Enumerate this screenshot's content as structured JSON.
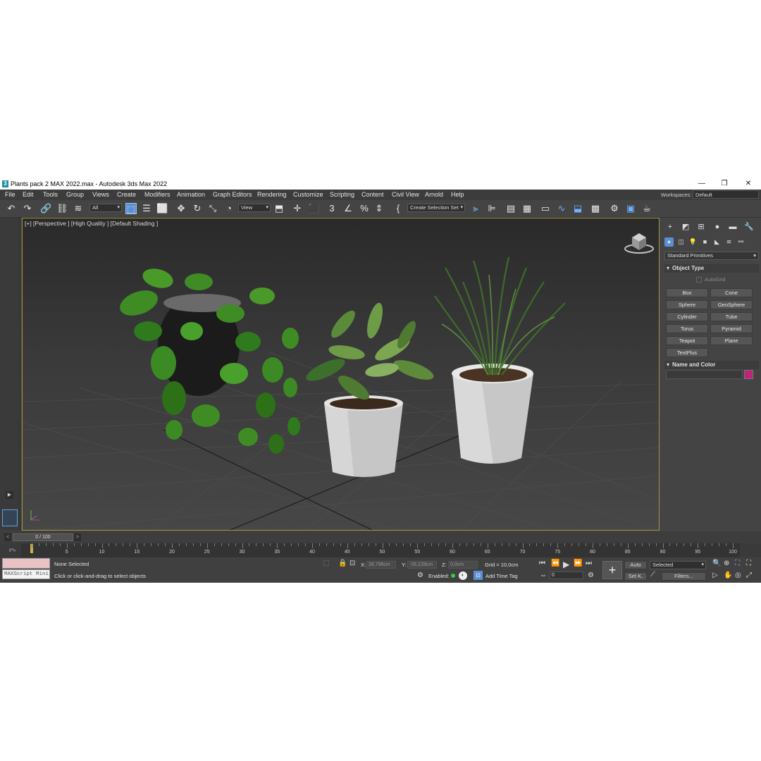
{
  "window": {
    "title": "Plants pack 2 MAX 2022.max - Autodesk 3ds Max 2022",
    "app_icon": "3",
    "min": "—",
    "max": "❐",
    "close": "✕"
  },
  "menu": [
    "File",
    "Edit",
    "Tools",
    "Group",
    "Views",
    "Create",
    "Modifiers",
    "Animation",
    "Graph Editors",
    "Rendering",
    "Customize",
    "Scripting",
    "Content",
    "Civil View",
    "Arnold",
    "Help"
  ],
  "workspaces": {
    "label": "Workspaces:",
    "value": "Default"
  },
  "toolbar": {
    "filter_value": "All",
    "refcoord_value": "View",
    "selection_set_value": "Create Selection Set"
  },
  "viewport": {
    "label": "[+] [Perspective ] [High Quality ] [Default Shading ]"
  },
  "command_panel": {
    "category_value": "Standard Primitives",
    "object_type_title": "Object Type",
    "autogrid_label": "AutoGrid",
    "buttons": [
      "Box",
      "Cone",
      "Sphere",
      "GeoSphere",
      "Cylinder",
      "Tube",
      "Torus",
      "Pyramid",
      "Teapot",
      "Plane",
      "TextPlus"
    ],
    "name_color_title": "Name and Color",
    "object_color": "#c0227a"
  },
  "timeline": {
    "slider_label": "0 / 100",
    "tick_labels": [
      "0",
      "5",
      "10",
      "15",
      "20",
      "25",
      "30",
      "35",
      "40",
      "45",
      "50",
      "55",
      "60",
      "65",
      "70",
      "75",
      "80",
      "85",
      "90",
      "95",
      "100"
    ],
    "curve_icon_label": "Ι⁄∿"
  },
  "status": {
    "maxscript_label": "MAXScript Mini",
    "selection_text": "None Selected",
    "prompt_text": "Click or click-and-drag to select objects",
    "x_label": "X:",
    "x_value": "28,796cm",
    "y_label": "Y:",
    "y_value": "-26,228cm",
    "z_label": "Z:",
    "z_value": "0,0cm",
    "grid_text": "Grid = 10,0cm",
    "enabled_label": "Enabled:",
    "add_time_tag": "Add Time Tag",
    "auto_label": "Auto",
    "setkey_label": "Set K.",
    "selected_value": "Selected",
    "filters_label": "Filters...",
    "frame_value": "0"
  }
}
